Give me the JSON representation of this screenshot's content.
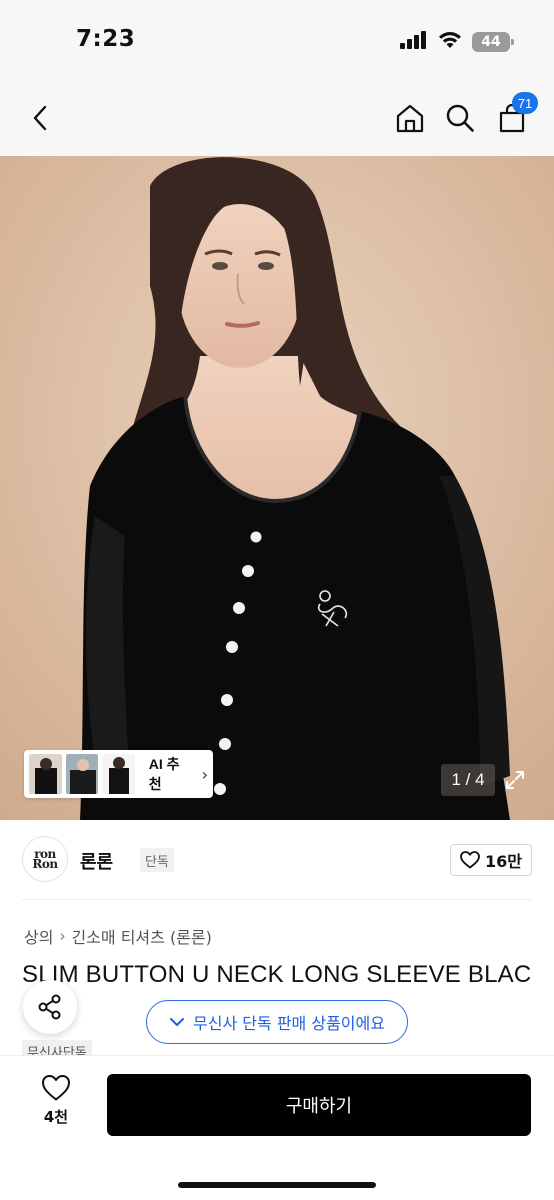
{
  "status_bar": {
    "time": "7:23",
    "battery": "44",
    "icons": [
      "signal-icon",
      "wifi-icon",
      "battery-icon"
    ]
  },
  "nav": {
    "icons": [
      "back-icon",
      "home-icon",
      "search-icon",
      "cart-icon"
    ],
    "cart_count": "71",
    "badge_color": "#1a73e8"
  },
  "gallery": {
    "ai_recommend_label": "AI 추천",
    "pager": "1 / 4"
  },
  "brand": {
    "logo_line1": "ron",
    "logo_line2": "Ron",
    "name": "론론",
    "tag": "단독",
    "likes": "16만"
  },
  "product": {
    "breadcrumb": [
      "상의",
      "긴소매 티셔츠 (론론)"
    ],
    "title": "SLIM BUTTON U NECK LONG SLEEVE BLAC",
    "musinsa_tag": "무신사단독",
    "exclusive_notice": "무신사 단독 판매 상품이에요"
  },
  "bottom_bar": {
    "wish_count": "4천",
    "buy_label": "구매하기",
    "buy_color": "#000000"
  }
}
